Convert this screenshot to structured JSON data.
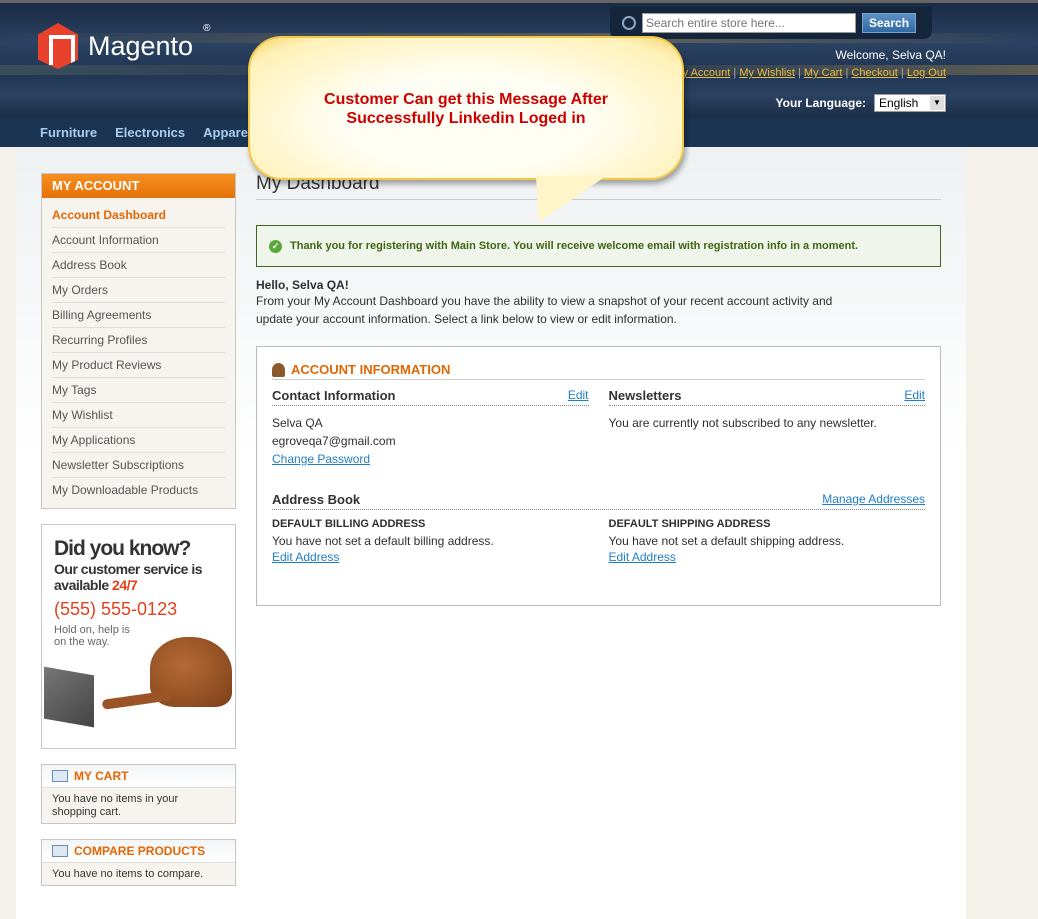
{
  "header": {
    "logo": "Magento",
    "search_placeholder": "Search entire store here...",
    "search_button": "Search",
    "welcome": "Welcome, Selva QA!",
    "links": [
      "My Account",
      "My Wishlist",
      "My Cart",
      "Checkout",
      "Log Out"
    ],
    "language_label": "Your Language:",
    "language_value": "English"
  },
  "nav": [
    "Furniture",
    "Electronics",
    "Apparel"
  ],
  "callout": {
    "line1": "Customer Can get this Message After",
    "line2": "Successfully Linkedin Loged in"
  },
  "sidebar": {
    "title": "MY ACCOUNT",
    "items": [
      "Account Dashboard",
      "Account Information",
      "Address Book",
      "My Orders",
      "Billing Agreements",
      "Recurring Profiles",
      "My Product Reviews",
      "My Tags",
      "My Wishlist",
      "My Applications",
      "Newsletter Subscriptions",
      "My Downloadable Products"
    ],
    "promo": {
      "title": "Did you know?",
      "line1": "Our customer service is",
      "line2": "available",
      "highlight": "24/7",
      "phone": "(555) 555-0123",
      "note1": "Hold on, help is",
      "note2": "on the way."
    },
    "cart": {
      "title": "MY CART",
      "text": "You have no items in your shopping cart."
    },
    "compare": {
      "title": "COMPARE PRODUCTS",
      "text": "You have no items to compare."
    }
  },
  "main": {
    "title": "My Dashboard",
    "success": "Thank you for registering with Main Store. You will receive welcome email with registration info in a moment.",
    "hello": "Hello, Selva QA!",
    "intro": "From your My Account Dashboard you have the ability to view a snapshot of your recent account activity and update your account information. Select a link below to view or edit information.",
    "account_info": {
      "title": "ACCOUNT INFORMATION",
      "contact_title": "Contact Information",
      "edit": "Edit",
      "name": "Selva QA",
      "email": "egroveqa7@gmail.com",
      "change_password": "Change Password",
      "newsletters_title": "Newsletters",
      "newsletters_text": "You are currently not subscribed to any newsletter.",
      "address_title": "Address Book",
      "manage": "Manage Addresses",
      "billing_title": "DEFAULT BILLING ADDRESS",
      "billing_text": "You have not set a default billing address.",
      "edit_address": "Edit Address",
      "shipping_title": "DEFAULT SHIPPING ADDRESS",
      "shipping_text": "You have not set a default shipping address."
    }
  }
}
